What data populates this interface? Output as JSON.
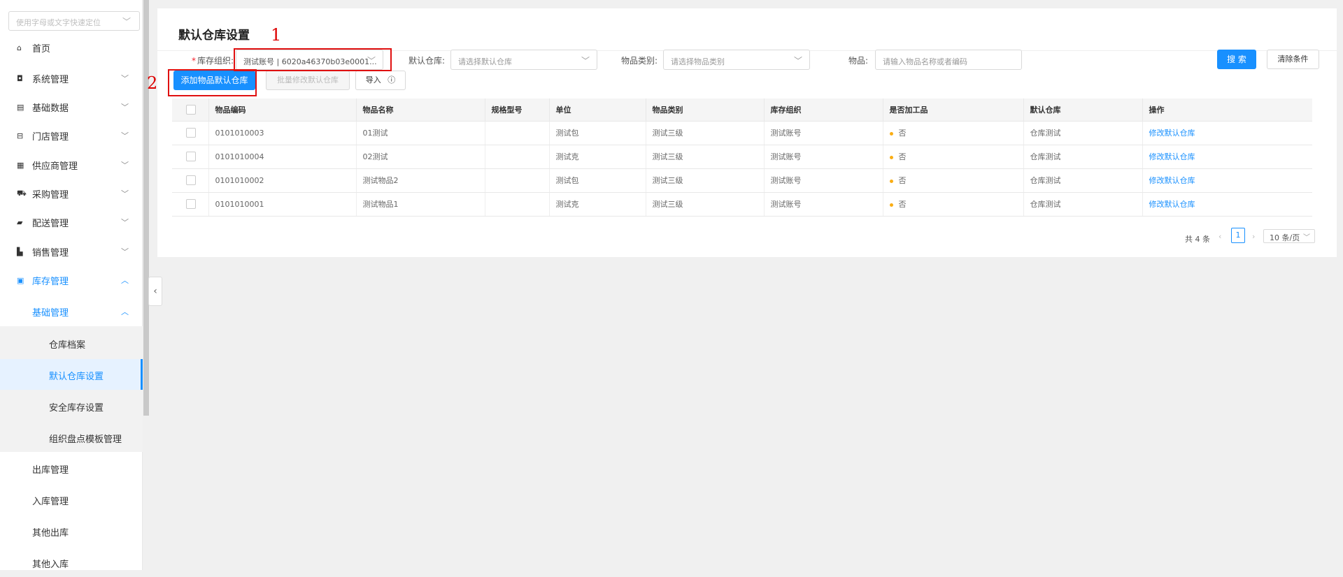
{
  "sidebar": {
    "search_placeholder": "使用字母或文字快速定位",
    "items": [
      {
        "label": "首页",
        "icon": "home-icon",
        "glyph": "⌂"
      },
      {
        "label": "系统管理",
        "icon": "settings-icon",
        "glyph": "◘"
      },
      {
        "label": "基础数据",
        "icon": "data-icon",
        "glyph": "▤"
      },
      {
        "label": "门店管理",
        "icon": "store-icon",
        "glyph": "⊟"
      },
      {
        "label": "供应商管理",
        "icon": "supplier-icon",
        "glyph": "▦"
      },
      {
        "label": "采购管理",
        "icon": "cart-icon",
        "glyph": "⛟"
      },
      {
        "label": "配送管理",
        "icon": "truck-icon",
        "glyph": "▰"
      },
      {
        "label": "销售管理",
        "icon": "sales-icon",
        "glyph": "▙"
      },
      {
        "label": "库存管理",
        "icon": "inventory-icon",
        "glyph": "▣"
      }
    ],
    "sub_parent": "基础管理",
    "sub_items": [
      "仓库档案",
      "默认仓库设置",
      "安全库存设置",
      "组织盘点模板管理"
    ],
    "after_items": [
      "出库管理",
      "入库管理",
      "其他出库",
      "其他入库"
    ]
  },
  "page": {
    "title": "默认仓库设置"
  },
  "filters": {
    "org_label": "库存组织",
    "org_value": "测试账号 | 6020a46370b03e0001...",
    "warehouse_label": "默认仓库",
    "warehouse_placeholder": "请选择默认仓库",
    "category_label": "物品类别",
    "category_placeholder": "请选择物品类别",
    "item_label": "物品",
    "item_placeholder": "请输入物品名称或者编码",
    "search_btn": "搜 索",
    "clear_btn": "清除条件"
  },
  "toolbar": {
    "add_btn": "添加物品默认仓库",
    "batch_btn": "批量修改默认仓库",
    "import_btn": "导入"
  },
  "annotations": {
    "one": "1",
    "two": "2"
  },
  "table": {
    "columns": [
      "物品编码",
      "物品名称",
      "规格型号",
      "单位",
      "物品类别",
      "库存组织",
      "是否加工品",
      "默认仓库",
      "操作"
    ],
    "rows": [
      {
        "code": "0101010003",
        "name": "01测试",
        "spec": "",
        "unit": "测试包",
        "category": "测试三级",
        "org": "测试账号",
        "processed": "否",
        "warehouse": "仓库测试",
        "action": "修改默认仓库"
      },
      {
        "code": "0101010004",
        "name": "02测试",
        "spec": "",
        "unit": "测试克",
        "category": "测试三级",
        "org": "测试账号",
        "processed": "否",
        "warehouse": "仓库测试",
        "action": "修改默认仓库"
      },
      {
        "code": "0101010002",
        "name": "测试物品2",
        "spec": "",
        "unit": "测试包",
        "category": "测试三级",
        "org": "测试账号",
        "processed": "否",
        "warehouse": "仓库测试",
        "action": "修改默认仓库"
      },
      {
        "code": "0101010001",
        "name": "测试物品1",
        "spec": "",
        "unit": "测试克",
        "category": "测试三级",
        "org": "测试账号",
        "processed": "否",
        "warehouse": "仓库测试",
        "action": "修改默认仓库"
      }
    ]
  },
  "pagination": {
    "total": "共 4 条",
    "page": "1",
    "page_size": "10 条/页"
  },
  "colors": {
    "primary": "#1890ff",
    "annotation": "#e01010",
    "status_dot": "#faad14"
  }
}
